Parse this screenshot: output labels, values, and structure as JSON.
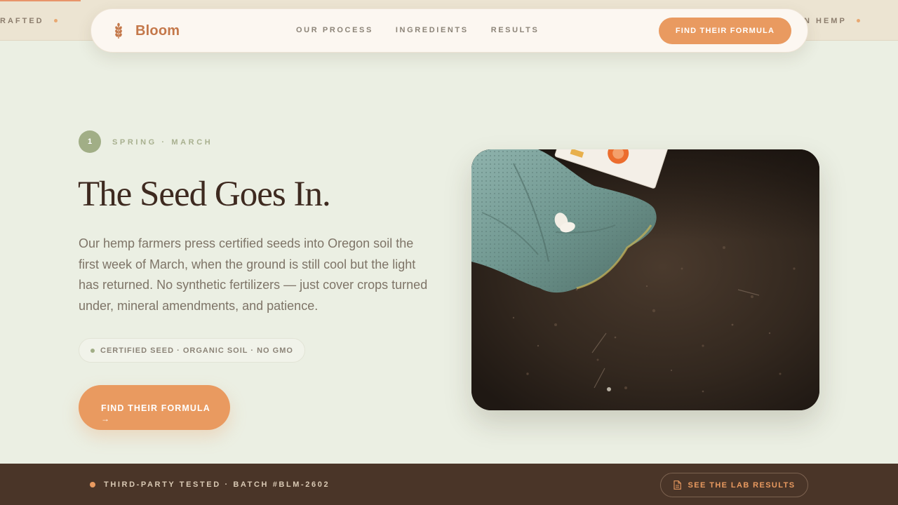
{
  "marquee": {
    "left_text": "RAFTED",
    "right_text": "N HEMP",
    "progress": 0.09
  },
  "brand": {
    "name": "Bloom",
    "logo_icon": "wheat-sprig-icon",
    "color": "#c4784a"
  },
  "nav": {
    "links": [
      "OUR PROCESS",
      "INGREDIENTS",
      "RESULTS"
    ],
    "cta_label": "FIND THEIR FORMULA"
  },
  "hero": {
    "step_number": "1",
    "step_label": "SPRING · MARCH",
    "title": "The Seed Goes In.",
    "body": "Our hemp farmers press certified seeds into Oregon soil the first week of March, when the ground is still cool but the light has returned. No synthetic fertilizers — just cover crops turned under, mineral amendments, and patience.",
    "tag": "CERTIFIED SEED · ORGANIC SOIL · NO GMO",
    "cta_label": "FIND THEIR FORMULA",
    "cta_icon": "arrow-right-icon",
    "cta_arrow": "→"
  },
  "footer": {
    "batch_text": "THIRD-PARTY TESTED · BATCH #BLM-2602",
    "lab_button_label": "SEE THE LAB RESULTS",
    "lab_button_icon": "document-icon"
  },
  "colors": {
    "accent": "#e99a60",
    "background": "#ebefe3",
    "footer_bg": "#4a3528",
    "sage": "#a1ae86",
    "ink": "#3e2a20"
  }
}
